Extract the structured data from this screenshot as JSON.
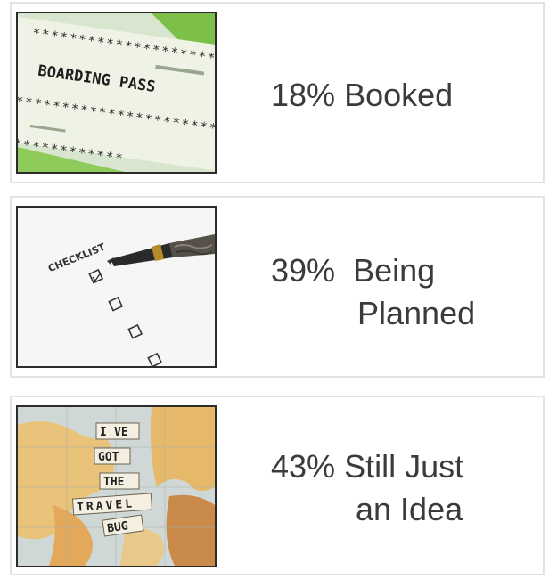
{
  "cards": [
    {
      "image_icon": "boarding-pass-icon",
      "image_text": "BOARDING PASS",
      "percent": "18%",
      "label_line1": "Booked",
      "label_line2": ""
    },
    {
      "image_icon": "checklist-icon",
      "image_text": "CHECKLIST",
      "percent": "39%",
      "label_line1": "Being",
      "label_line2": "Planned"
    },
    {
      "image_icon": "travel-map-icon",
      "image_tiles": [
        "I",
        "VE",
        "GOT",
        "THE",
        "TRAVEL",
        "BUG"
      ],
      "percent": "43%",
      "label_line1": "Still Just",
      "label_line2": "an Idea"
    }
  ],
  "colors": {
    "text": "#3b3b3b",
    "card_border": "#e3e3e3",
    "ticket_green": "#7cc04a"
  }
}
